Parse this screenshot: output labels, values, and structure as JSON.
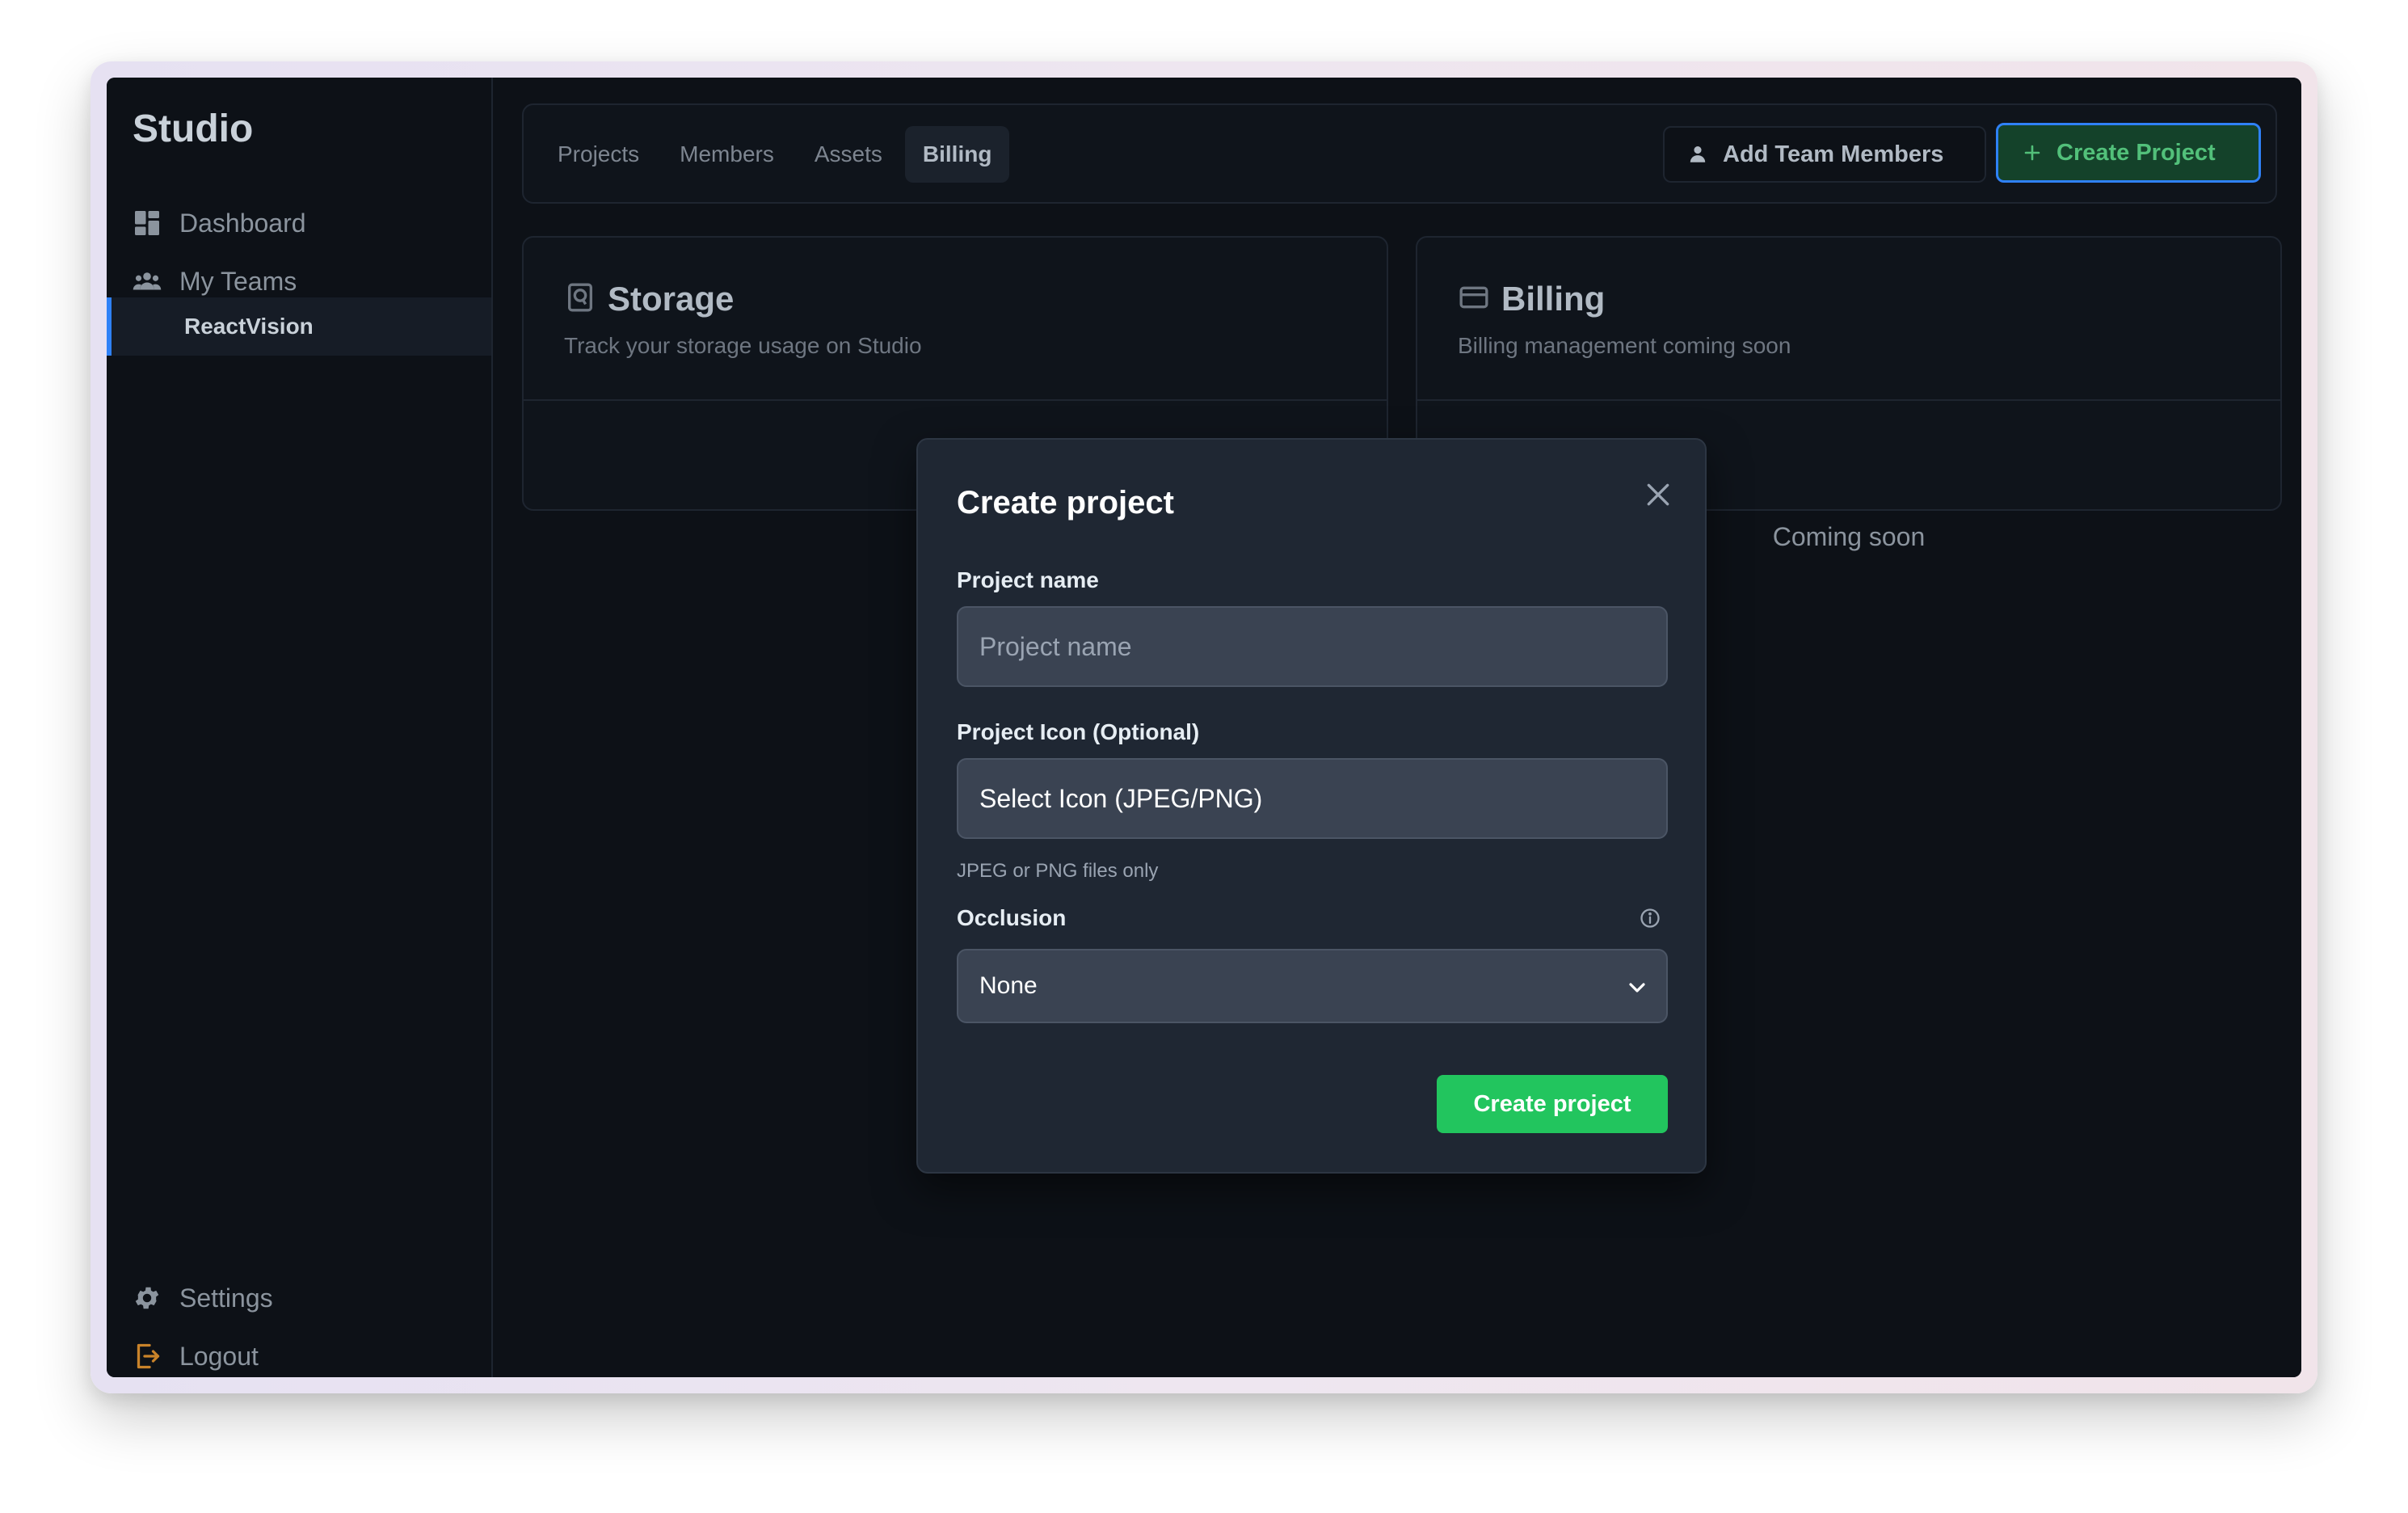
{
  "sidebar": {
    "brand": "Studio",
    "items": [
      {
        "label": "Dashboard",
        "icon": "dashboard-icon"
      },
      {
        "label": "My Teams",
        "icon": "teams-icon"
      }
    ],
    "sub_item": "ReactVision",
    "bottom_items": [
      {
        "label": "Settings",
        "icon": "gear-icon"
      },
      {
        "label": "Logout",
        "icon": "logout-icon"
      }
    ]
  },
  "header": {
    "tabs": [
      {
        "label": "Projects",
        "active": false
      },
      {
        "label": "Members",
        "active": false
      },
      {
        "label": "Assets",
        "active": false
      },
      {
        "label": "Billing",
        "active": true
      }
    ],
    "add_members_label": "Add Team Members",
    "create_project_label": "Create Project"
  },
  "cards": {
    "storage": {
      "title": "Storage",
      "description": "Track your storage usage on Studio",
      "icon": "drive-icon"
    },
    "billing": {
      "title": "Billing",
      "description": "Billing management coming soon",
      "body": "Coming soon",
      "icon": "credit-card-icon"
    }
  },
  "modal": {
    "title": "Create project",
    "name_label": "Project name",
    "name_placeholder": "Project name",
    "name_value": "",
    "icon_label": "Project Icon (Optional)",
    "icon_button": "Select Icon (JPEG/PNG)",
    "icon_hint": "JPEG or PNG files only",
    "occlusion_label": "Occlusion",
    "occlusion_value": "None",
    "submit_label": "Create project"
  },
  "colors": {
    "accent_green": "#22c55e",
    "focus_blue": "#2f81f7",
    "background": "#0d1117",
    "modal_bg": "#1f2733"
  }
}
